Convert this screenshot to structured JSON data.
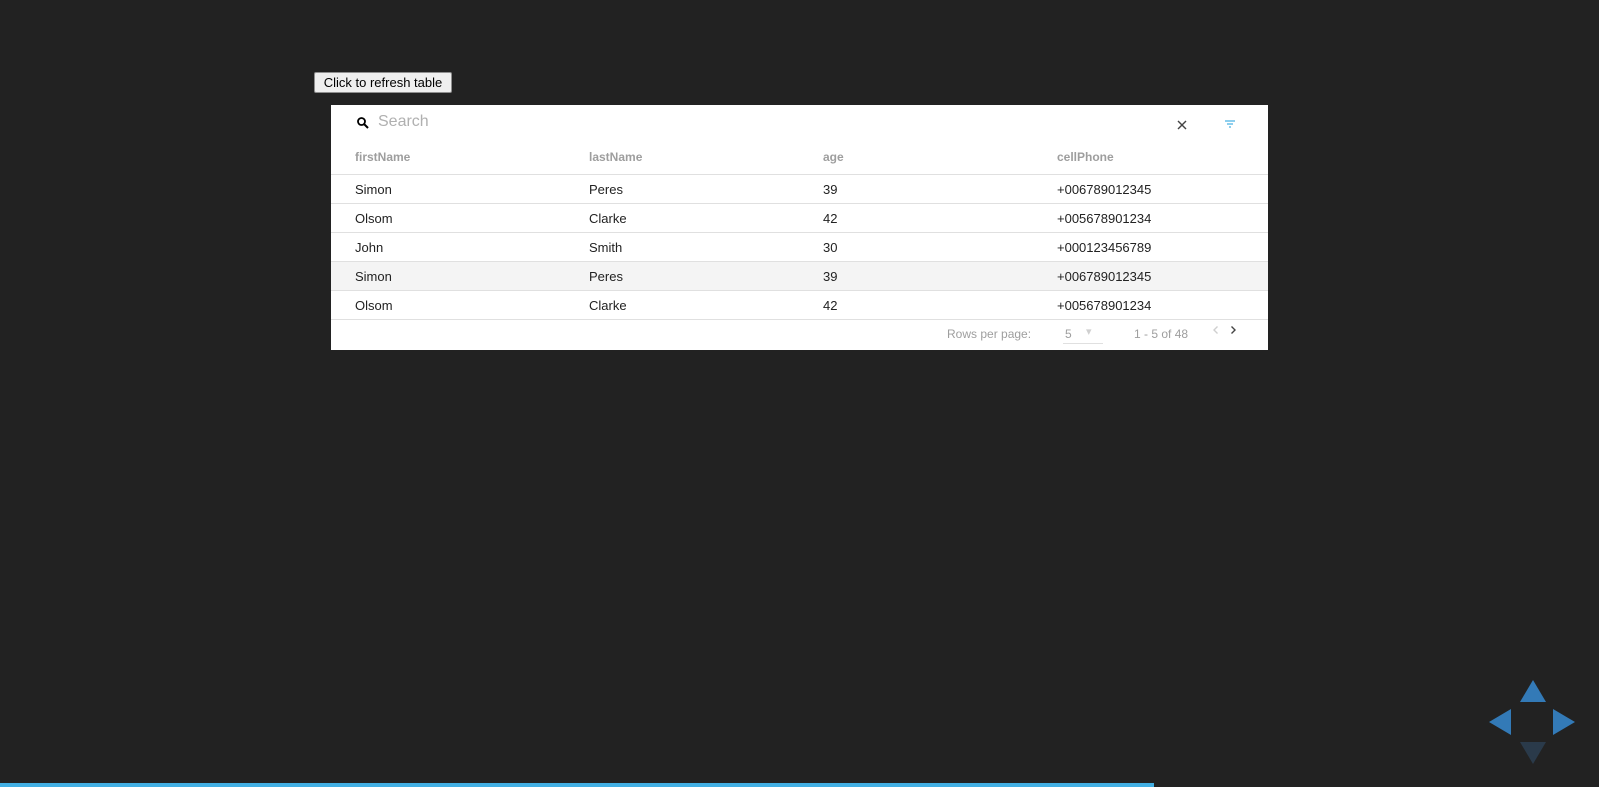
{
  "refresh_button": {
    "label": "Click to refresh table"
  },
  "search": {
    "placeholder": "Search",
    "value": ""
  },
  "table": {
    "columns": [
      "firstName",
      "lastName",
      "age",
      "cellPhone"
    ],
    "rows": [
      [
        "Simon",
        "Peres",
        "39",
        "+006789012345"
      ],
      [
        "Olsom",
        "Clarke",
        "42",
        "+005678901234"
      ],
      [
        "John",
        "Smith",
        "30",
        "+000123456789"
      ],
      [
        "Simon",
        "Peres",
        "39",
        "+006789012345"
      ],
      [
        "Olsom",
        "Clarke",
        "42",
        "+005678901234"
      ]
    ]
  },
  "pagination": {
    "rows_per_page_label": "Rows per page:",
    "rows_per_page_value": "5",
    "range_text": "1 - 5 of 48"
  },
  "progress": {
    "fraction": 0.722
  },
  "colors": {
    "background": "#222222",
    "accent": "#42afe3",
    "nav_arrow": "#337ab7",
    "nav_arrow_disabled": "#2a3a4a"
  },
  "icons": {
    "search": "search-icon",
    "clear": "close-icon",
    "filter": "filter-icon",
    "prev": "chevron-left-icon",
    "next": "chevron-right-icon"
  }
}
